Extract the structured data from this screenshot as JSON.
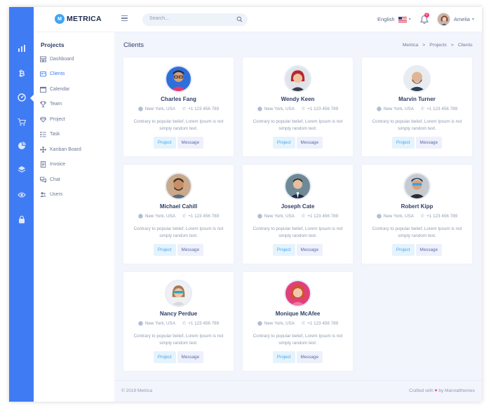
{
  "app": {
    "logo_text": "METRICA",
    "logo_mark": "M"
  },
  "search": {
    "placeholder": "Search..."
  },
  "topbar": {
    "language": "English",
    "notification_count": "2",
    "user_name": "Amelia"
  },
  "rail": {
    "icons": [
      "bar-chart-icon",
      "bitcoin-icon",
      "dashboard-gauge-icon",
      "cart-icon",
      "pie-chart-icon",
      "layers-icon",
      "eye-icon",
      "lock-icon"
    ]
  },
  "menu": {
    "title": "Projects",
    "items": [
      {
        "label": "Dashboard",
        "icon": "dashboard-icon"
      },
      {
        "label": "Clients",
        "icon": "clients-icon"
      },
      {
        "label": "Calendar",
        "icon": "calendar-icon"
      },
      {
        "label": "Team",
        "icon": "trophy-icon"
      },
      {
        "label": "Project",
        "icon": "diamond-icon"
      },
      {
        "label": "Task",
        "icon": "task-list-icon"
      },
      {
        "label": "Kanban Board",
        "icon": "kanban-icon"
      },
      {
        "label": "Invoice",
        "icon": "invoice-icon"
      },
      {
        "label": "Chat",
        "icon": "chat-icon"
      },
      {
        "label": "Users",
        "icon": "users-icon"
      }
    ]
  },
  "page": {
    "title": "Clients",
    "breadcrumb": [
      "Metrica",
      ">",
      "Projects",
      ">",
      "Clients"
    ]
  },
  "clients": [
    {
      "name": "Charles Fang",
      "location": "New York, USA",
      "phone": "+1 123 456 789",
      "desc": "Contrary to popular belief, Lorem Ipsum is not simply random text.",
      "project_label": "Project",
      "message_label": "Message"
    },
    {
      "name": "Wendy Keen",
      "location": "New York, USA",
      "phone": "+1 123 456 789",
      "desc": "Contrary to popular belief, Lorem Ipsum is not simply random text.",
      "project_label": "Project",
      "message_label": "Message"
    },
    {
      "name": "Marvin Turner",
      "location": "New York, USA",
      "phone": "+1 123 456 789",
      "desc": "Contrary to popular belief, Lorem Ipsum is not simply random text.",
      "project_label": "Project",
      "message_label": "Message"
    },
    {
      "name": "Michael Cahill",
      "location": "New York, USA",
      "phone": "+1 123 456 789",
      "desc": "Contrary to popular belief, Lorem Ipsum is not simply random text.",
      "project_label": "Project",
      "message_label": "Message"
    },
    {
      "name": "Joseph Cate",
      "location": "New York, USA",
      "phone": "+1 123 456 789",
      "desc": "Contrary to popular belief, Lorem Ipsum is not simply random text.",
      "project_label": "Project",
      "message_label": "Message"
    },
    {
      "name": "Robert Kipp",
      "location": "New York, USA",
      "phone": "+1 123 456 789",
      "desc": "Contrary to popular belief, Lorem Ipsum is not simply random text.",
      "project_label": "Project",
      "message_label": "Message"
    },
    {
      "name": "Nancy Perdue",
      "location": "New York, USA",
      "phone": "+1 123 456 789",
      "desc": "Contrary to popular belief, Lorem Ipsum is not simply random text.",
      "project_label": "Project",
      "message_label": "Message"
    },
    {
      "name": "Monique McAfee",
      "location": "New York, USA",
      "phone": "+1 123 456 789",
      "desc": "Contrary to popular belief, Lorem Ipsum is not simply random text.",
      "project_label": "Project",
      "message_label": "Message"
    }
  ],
  "footer": {
    "copyright": "© 2019 Metrica",
    "crafted_prefix": "Crafted with",
    "heart": "♥",
    "crafted_suffix": "by Mannatthemes"
  },
  "colors": {
    "accent": "#3f7cf4",
    "project_button_text": "#3fa6f2",
    "badge": "#f1416c"
  }
}
